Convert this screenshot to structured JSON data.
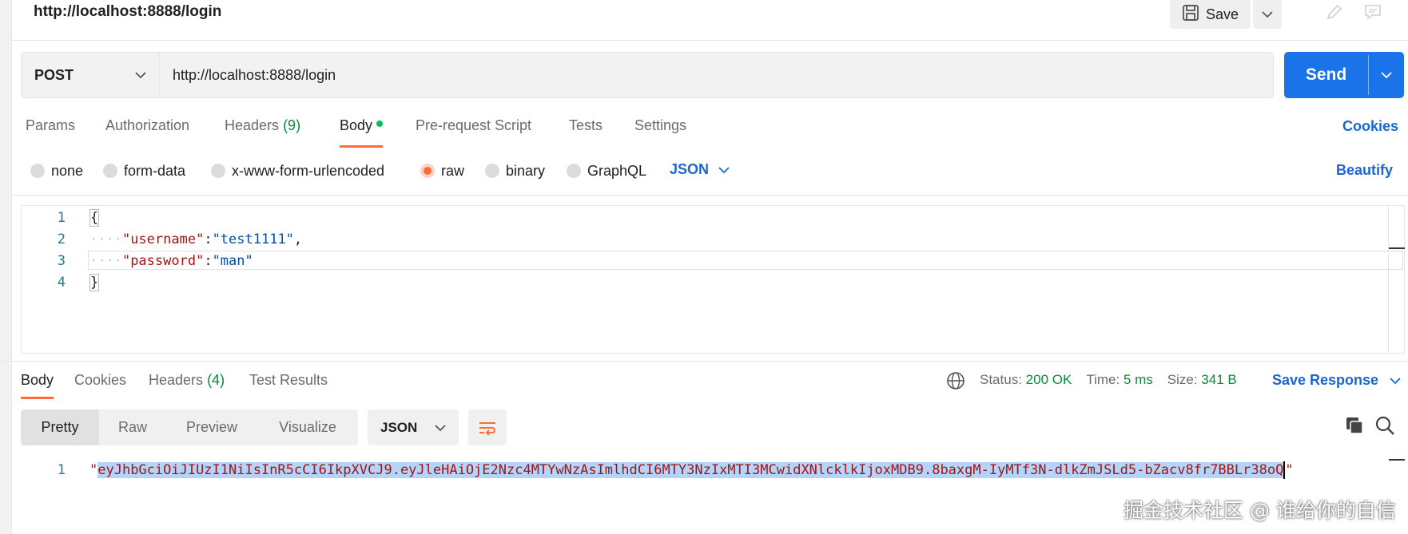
{
  "window": {
    "title": "http://localhost:8888/login"
  },
  "toolbar": {
    "save_label": "Save"
  },
  "request": {
    "method": "POST",
    "url": "http://localhost:8888/login",
    "send_label": "Send"
  },
  "request_tabs": [
    {
      "label": "Params"
    },
    {
      "label": "Authorization"
    },
    {
      "label": "Headers",
      "count": "(9)"
    },
    {
      "label": "Body",
      "active": true
    },
    {
      "label": "Pre-request Script"
    },
    {
      "label": "Tests"
    },
    {
      "label": "Settings"
    }
  ],
  "cookies_label": "Cookies",
  "body_types": [
    {
      "label": "none"
    },
    {
      "label": "form-data"
    },
    {
      "label": "x-www-form-urlencoded"
    },
    {
      "label": "raw",
      "selected": true
    },
    {
      "label": "binary"
    },
    {
      "label": "GraphQL"
    }
  ],
  "body_format": "JSON",
  "beautify_label": "Beautify",
  "editor": {
    "line_numbers": [
      "1",
      "2",
      "3",
      "4"
    ],
    "open_brace": "{",
    "close_brace": "}",
    "key1": "\"username\"",
    "val1": "\"test1111\"",
    "key2": "\"password\"",
    "val2": "\"man\"",
    "colon": ":",
    "comma": ",",
    "indent": "····"
  },
  "response_tabs": [
    {
      "label": "Body",
      "active": true
    },
    {
      "label": "Cookies"
    },
    {
      "label": "Headers",
      "count": "(4)"
    },
    {
      "label": "Test Results"
    }
  ],
  "response_status": {
    "status_label": "Status:",
    "status_value": "200 OK",
    "time_label": "Time:",
    "time_value": "5 ms",
    "size_label": "Size:",
    "size_value": "341 B"
  },
  "save_response_label": "Save Response",
  "view_modes": [
    "Pretty",
    "Raw",
    "Preview",
    "Visualize"
  ],
  "response_format": "JSON",
  "response_body": {
    "line_number": "1",
    "quote": "\"",
    "token": "eyJhbGciOiJIUzI1NiIsInR5cCI6IkpXVCJ9.eyJleHAiOjE2Nzc4MTYwNzAsImlhdCI6MTY3NzIxMTI3MCwidXNlcklkIjoxMDB9.8baxgM-IyMTf3N-dlkZmJSLd5-bZacv8fr7BBLr38oQ"
  },
  "watermark": "掘金技术社区 @ 谁给你的自信",
  "colors": {
    "accent": "#ff6c37",
    "send": "#1a73e8",
    "link": "#1a67d2",
    "success": "#0a8a3a"
  }
}
